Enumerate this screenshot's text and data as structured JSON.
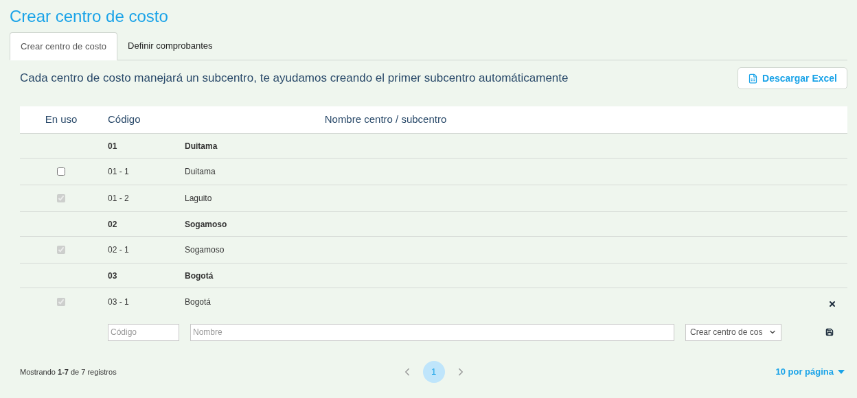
{
  "title": "Crear centro de costo",
  "tabs": [
    {
      "label": "Crear centro de costo",
      "selected": true
    },
    {
      "label": "Definir comprobantes",
      "selected": false
    }
  ],
  "description": "Cada centro de costo manejará un subcentro, te ayudamos creando el primer subcentro automáticamente",
  "download_button": "Descargar Excel",
  "table": {
    "columns": [
      "En uso",
      "Código",
      "Nombre centro / subcentro"
    ],
    "rows": [
      {
        "kind": "group",
        "code": "01",
        "name": "Duitama"
      },
      {
        "kind": "item",
        "code": "01 - 1",
        "name": "Duitama",
        "checked": false,
        "disabled": false,
        "deletable": false
      },
      {
        "kind": "item",
        "code": "01 - 2",
        "name": "Laguito",
        "checked": true,
        "disabled": true,
        "deletable": false
      },
      {
        "kind": "group",
        "code": "02",
        "name": "Sogamoso"
      },
      {
        "kind": "item",
        "code": "02 - 1",
        "name": "Sogamoso",
        "checked": true,
        "disabled": true,
        "deletable": false
      },
      {
        "kind": "group",
        "code": "03",
        "name": "Bogotá"
      },
      {
        "kind": "item",
        "code": "03 - 1",
        "name": "Bogotá",
        "checked": true,
        "disabled": true,
        "deletable": true
      }
    ],
    "new_row": {
      "code_placeholder": "Código",
      "name_placeholder": "Nombre",
      "type_value": "Crear centro de cos"
    }
  },
  "footer": {
    "summary": "Mostrando **1-7** de 7 registros",
    "pages": [
      {
        "label": "1",
        "selected": true
      }
    ],
    "page_size": "10 por página"
  }
}
